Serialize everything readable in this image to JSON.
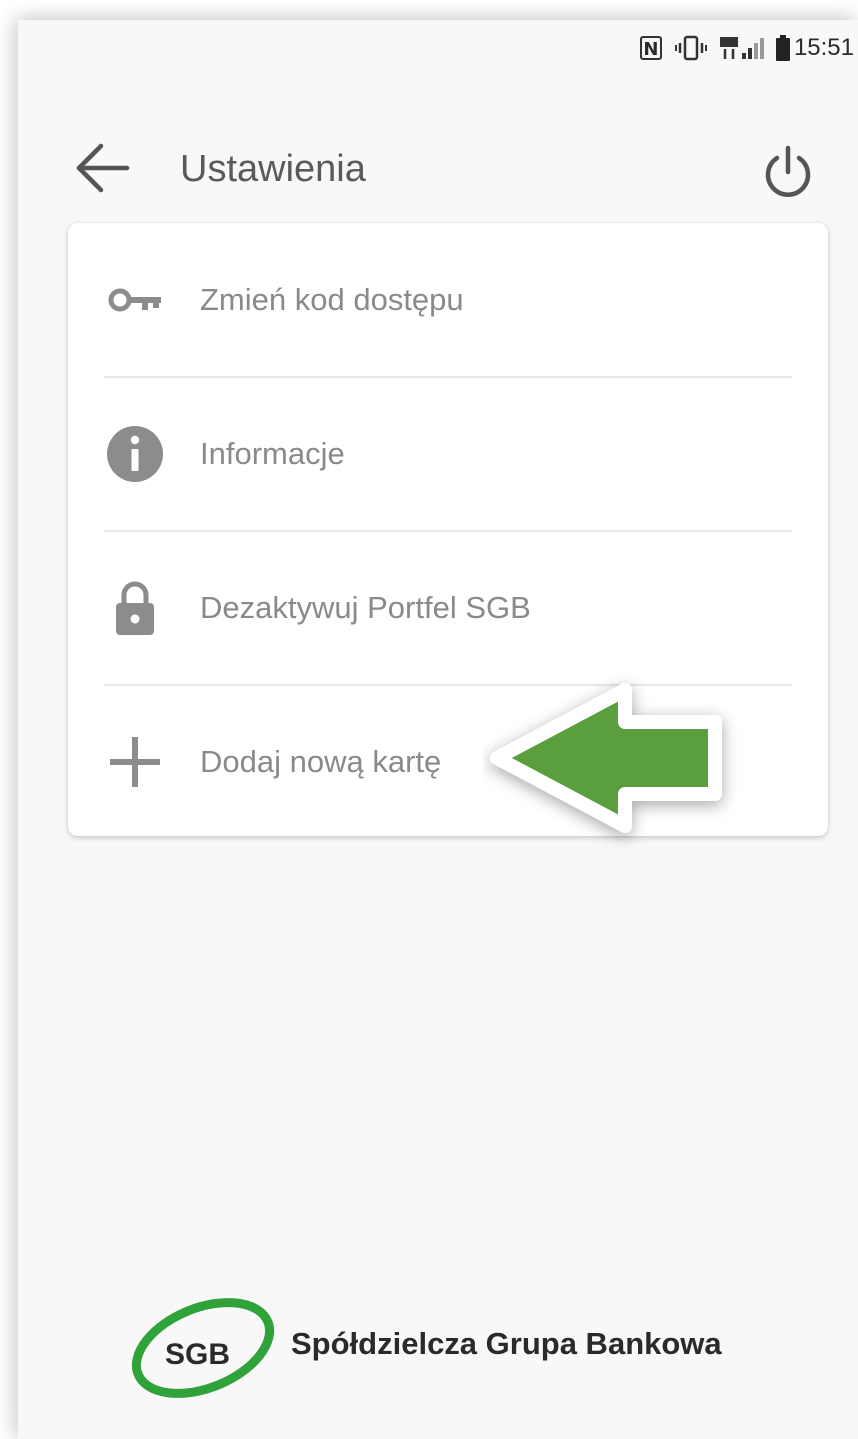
{
  "status_bar": {
    "time": "15:51",
    "icons": [
      "nfc-icon",
      "vibrate-icon",
      "signal-icon",
      "battery-icon"
    ]
  },
  "toolbar": {
    "title": "Ustawienia",
    "back_icon": "arrow-left-icon",
    "power_icon": "power-icon"
  },
  "menu": {
    "items": [
      {
        "label": "Zmień kod dostępu",
        "icon": "key-icon"
      },
      {
        "label": "Informacje",
        "icon": "info-icon"
      },
      {
        "label": "Dezaktywuj Portfel SGB",
        "icon": "lock-icon"
      },
      {
        "label": "Dodaj nową kartę",
        "icon": "plus-icon"
      }
    ]
  },
  "annotation": {
    "icon": "green-arrow-icon",
    "color": "#5a9e3e"
  },
  "footer": {
    "logo_text": "SGB",
    "bank_name": "Spółdzielcza Grupa Bankowa",
    "brand_color": "#2fa33a"
  },
  "colors": {
    "background": "#f8f8f8",
    "card": "#ffffff",
    "text_secondary": "#8a8a8a",
    "icon": "#8c8c8c"
  }
}
